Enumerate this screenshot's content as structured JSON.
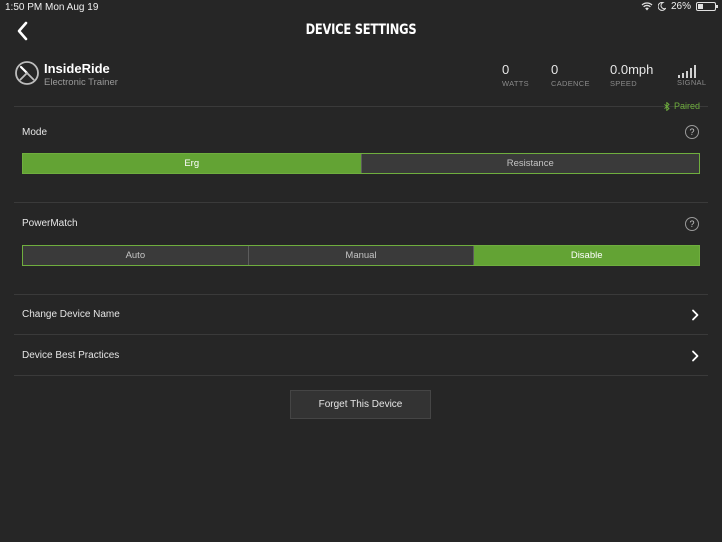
{
  "status_bar": {
    "time": "1:50 PM",
    "date": "Mon Aug 19",
    "battery": "26%"
  },
  "nav": {
    "title": "DEVICE SETTINGS"
  },
  "device": {
    "name": "InsideRide",
    "type": "Electronic Trainer",
    "metrics": [
      {
        "value": "0",
        "label": "WATTS"
      },
      {
        "value": "0",
        "label": "CADENCE"
      },
      {
        "value": "0.0mph",
        "label": "SPEED"
      }
    ],
    "signal_label": "SIGNAL",
    "status": "Paired"
  },
  "mode": {
    "label": "Mode",
    "options": [
      "Erg",
      "Resistance"
    ],
    "selected": "Erg"
  },
  "powermatch": {
    "label": "PowerMatch",
    "options": [
      "Auto",
      "Manual",
      "Disable"
    ],
    "selected": "Disable"
  },
  "menu": [
    {
      "label": "Change Device Name"
    },
    {
      "label": "Device Best Practices"
    }
  ],
  "forget_button": "Forget This Device",
  "colors": {
    "accent": "#63a334",
    "background": "#262626"
  }
}
